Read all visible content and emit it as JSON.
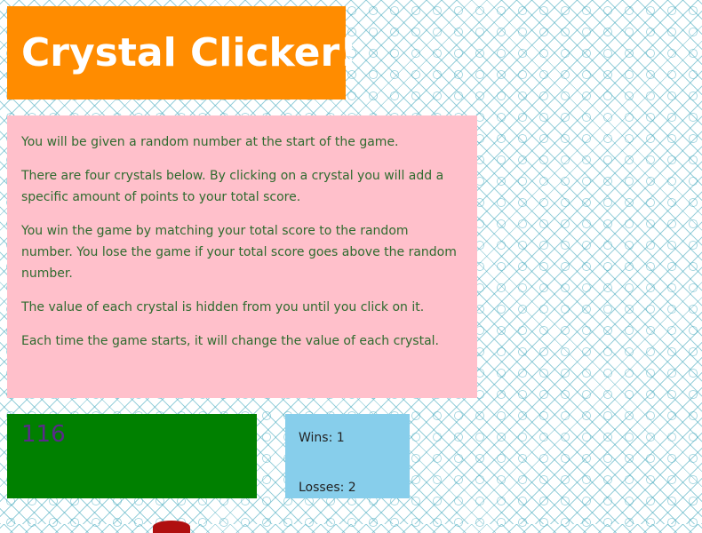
{
  "header": {
    "title": "Crystal Clicker!"
  },
  "instructions": {
    "paragraphs": [
      "You will be given a random number at the start of the game.",
      "There are four crystals below. By clicking on a crystal you will add a specific amount of points to your total score.",
      "You win the game by matching your total score to the random number. You lose the game if your total score goes above the random number.",
      "The value of each crystal is hidden from you until you click on it.",
      "Each time the game starts, it will change the value of each crystal."
    ]
  },
  "game": {
    "target_number": "116",
    "wins_text": "Wins: 1",
    "losses_text": "Losses: 2"
  },
  "colors": {
    "title_bg": "#ff8c00",
    "instructions_bg": "#ffc0cb",
    "target_bg": "#008000",
    "score_bg": "#87ceeb",
    "crystal_red": "#b01010"
  }
}
